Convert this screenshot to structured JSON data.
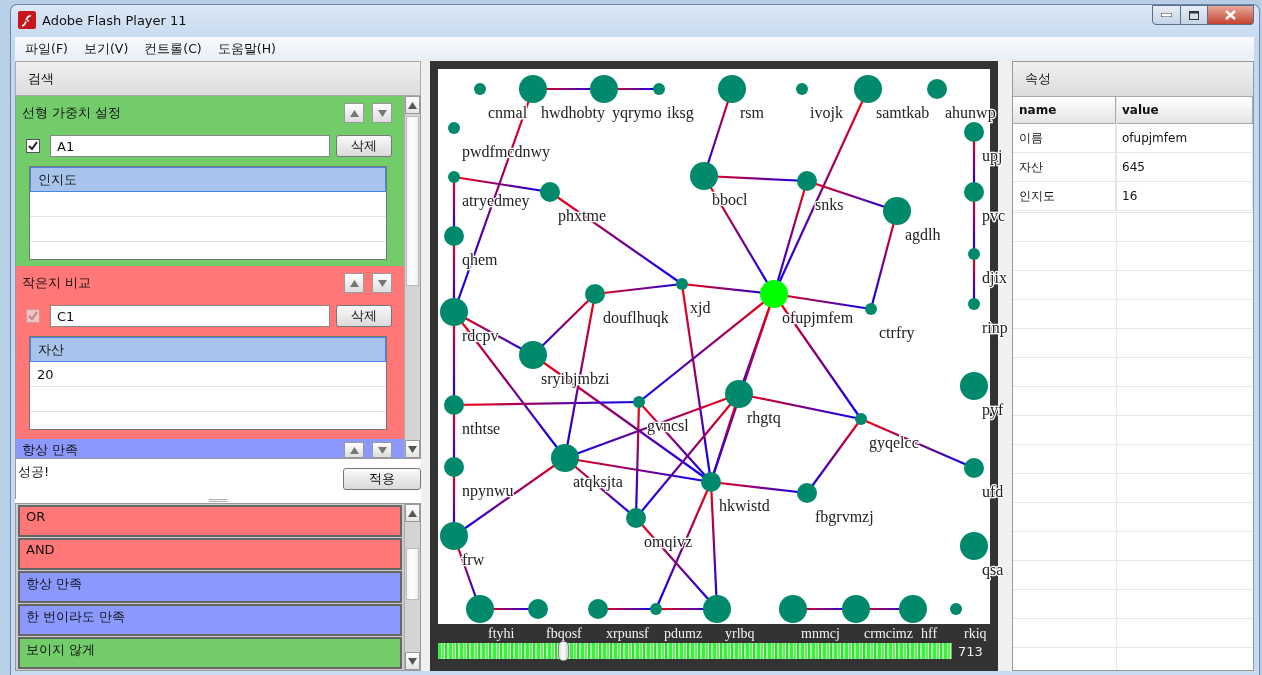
{
  "window": {
    "title": "Adobe Flash Player 11"
  },
  "menu": [
    "파일(F)",
    "보기(V)",
    "컨트롤(C)",
    "도움말(H)"
  ],
  "search_panel": {
    "title": "검색",
    "filters": [
      {
        "title": "선형 가중치 설정",
        "color": "#72cc6a",
        "checked": true,
        "disabled": false,
        "value": "A1",
        "delete_label": "삭제",
        "list": [
          {
            "text": "인지도",
            "selected": true
          }
        ]
      },
      {
        "title": "작은지 비교",
        "color": "#ff7777",
        "checked": true,
        "disabled": true,
        "value": "C1",
        "delete_label": "삭제",
        "list": [
          {
            "text": "자산",
            "selected": true
          },
          {
            "text": "20",
            "selected": false
          }
        ]
      },
      {
        "title": "항상 만족",
        "color": "#8b99ff"
      }
    ],
    "message": "성공!",
    "apply_label": "적용",
    "palette": [
      {
        "text": "OR",
        "color": "#ff7777"
      },
      {
        "text": "AND",
        "color": "#ff7777"
      },
      {
        "text": "항상 만족",
        "color": "#8b99ff"
      },
      {
        "text": "한 번이라도 만족",
        "color": "#8b99ff"
      },
      {
        "text": "보이지 않게",
        "color": "#72cc6a"
      }
    ]
  },
  "graph": {
    "nodes": [
      {
        "label": "cnmal",
        "kind": "small",
        "selected": false
      },
      {
        "label": "hwdhobty",
        "kind": "large",
        "selected": false
      },
      {
        "label": "yqrymo",
        "kind": "large",
        "selected": false
      },
      {
        "label": "iksg",
        "kind": "small",
        "selected": false
      },
      {
        "label": "rsm",
        "kind": "large",
        "selected": false
      },
      {
        "label": "ivojk",
        "kind": "small",
        "selected": false
      },
      {
        "label": "samtkab",
        "kind": "large",
        "selected": false
      },
      {
        "label": "ahunwp",
        "kind": "medium",
        "selected": false
      },
      {
        "label": "pwdfmcdnwy",
        "kind": "small",
        "selected": false
      },
      {
        "label": "atryedmey",
        "kind": "small",
        "selected": false
      },
      {
        "label": "phxtme",
        "kind": "medium",
        "selected": false
      },
      {
        "label": "qhem",
        "kind": "medium",
        "selected": false
      },
      {
        "label": "bbocl",
        "kind": "large",
        "selected": false
      },
      {
        "label": "snks",
        "kind": "medium",
        "selected": false
      },
      {
        "label": "agdlh",
        "kind": "large",
        "selected": false
      },
      {
        "label": "upj",
        "kind": "medium",
        "selected": false
      },
      {
        "label": "pvc",
        "kind": "medium",
        "selected": false
      },
      {
        "label": "djix",
        "kind": "small",
        "selected": false
      },
      {
        "label": "rinp",
        "kind": "small",
        "selected": false
      },
      {
        "label": "rdcpv",
        "kind": "large",
        "selected": false
      },
      {
        "label": "douflhuqk",
        "kind": "medium",
        "selected": false
      },
      {
        "label": "xjd",
        "kind": "small",
        "selected": false
      },
      {
        "label": "ofupjmfem",
        "kind": "large",
        "selected": true
      },
      {
        "label": "ctrfry",
        "kind": "small",
        "selected": false
      },
      {
        "label": "sryibjmbzi",
        "kind": "large",
        "selected": false
      },
      {
        "label": "nthtse",
        "kind": "medium",
        "selected": false
      },
      {
        "label": "gvncsl",
        "kind": "small",
        "selected": false
      },
      {
        "label": "rhgtq",
        "kind": "large",
        "selected": false
      },
      {
        "label": "gyqelcc",
        "kind": "small",
        "selected": false
      },
      {
        "label": "pyf",
        "kind": "large",
        "selected": false
      },
      {
        "label": "npynwu",
        "kind": "medium",
        "selected": false
      },
      {
        "label": "atqksjta",
        "kind": "large",
        "selected": false
      },
      {
        "label": "hkwistd",
        "kind": "medium",
        "selected": false
      },
      {
        "label": "fbgrvmzj",
        "kind": "medium",
        "selected": false
      },
      {
        "label": "ufd",
        "kind": "medium",
        "selected": false
      },
      {
        "label": "omqivz",
        "kind": "medium",
        "selected": false
      },
      {
        "label": "frw",
        "kind": "large",
        "selected": false
      },
      {
        "label": "qsa",
        "kind": "large",
        "selected": false
      },
      {
        "label": "ftyhi",
        "kind": "large",
        "selected": false
      },
      {
        "label": "fbqosf",
        "kind": "medium",
        "selected": false
      },
      {
        "label": "xrpunsf",
        "kind": "medium",
        "selected": false
      },
      {
        "label": "pdumz",
        "kind": "small",
        "selected": false
      },
      {
        "label": "yrlbq",
        "kind": "large",
        "selected": false
      },
      {
        "label": "mnmcj",
        "kind": "large",
        "selected": false
      },
      {
        "label": "crmcimz",
        "kind": "large",
        "selected": false
      },
      {
        "label": "hff",
        "kind": "large",
        "selected": false
      },
      {
        "label": "rkiq",
        "kind": "small",
        "selected": false
      }
    ],
    "slider": {
      "level": 0.243,
      "reading": "713"
    }
  },
  "properties": {
    "title": "속성",
    "columns": [
      "name",
      "value"
    ],
    "rows": [
      [
        "이름",
        "ofupjmfem"
      ],
      [
        "자산",
        "645"
      ],
      [
        "인지도",
        "16"
      ]
    ]
  }
}
